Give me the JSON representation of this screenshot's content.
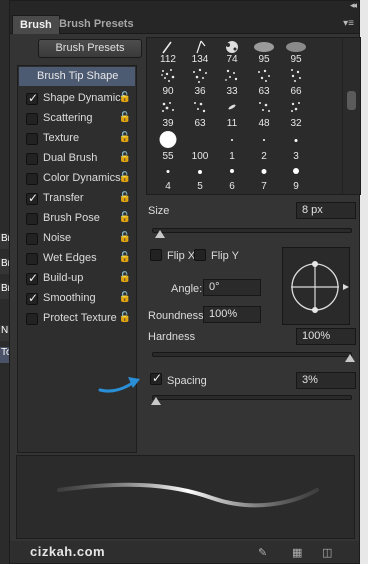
{
  "tabs": [
    {
      "label": "Brush"
    },
    {
      "label": "Brush Presets"
    }
  ],
  "brush_presets_button": "Brush Presets",
  "options": [
    {
      "label": "Brush Tip Shape",
      "selected": true
    },
    {
      "label": "Shape Dynamics",
      "checked": true
    },
    {
      "label": "Scattering",
      "checked": false
    },
    {
      "label": "Texture",
      "checked": false
    },
    {
      "label": "Dual Brush",
      "checked": false
    },
    {
      "label": "Color Dynamics",
      "checked": false
    },
    {
      "label": "Transfer",
      "checked": true
    },
    {
      "label": "Brush Pose",
      "checked": false
    },
    {
      "label": "Noise",
      "checked": false
    },
    {
      "label": "Wet Edges",
      "checked": false
    },
    {
      "label": "Build-up",
      "checked": true
    },
    {
      "label": "Smoothing",
      "checked": true
    },
    {
      "label": "Protect Texture",
      "checked": false
    }
  ],
  "tip_sizes": [
    [
      "112",
      "134",
      "74",
      "95",
      "95"
    ],
    [
      "90",
      "36",
      "33",
      "63",
      "66"
    ],
    [
      "39",
      "63",
      "11",
      "48",
      "32"
    ],
    [
      "55",
      "100",
      "1",
      "2",
      "3"
    ],
    [
      "4",
      "5",
      "6",
      "7",
      "9"
    ]
  ],
  "size": {
    "label": "Size",
    "value": "8 px",
    "level": 0.02
  },
  "flip_x": {
    "label": "Flip X",
    "checked": false
  },
  "flip_y": {
    "label": "Flip Y",
    "checked": false
  },
  "angle": {
    "label": "Angle:",
    "value": "0°"
  },
  "roundness": {
    "label": "Roundness:",
    "value": "100%"
  },
  "hardness": {
    "label": "Hardness",
    "value": "100%",
    "level": 1.0
  },
  "spacing": {
    "label": "Spacing",
    "value": "3%",
    "checked": true,
    "level": 0.0
  },
  "watermark": "cizkah.com",
  "left_cut_labels": [
    "Br",
    "Br",
    "Br",
    "N",
    "To"
  ],
  "colors": {
    "accent_blue": "#2a8fd6",
    "selected_row": "#4c5a72"
  }
}
